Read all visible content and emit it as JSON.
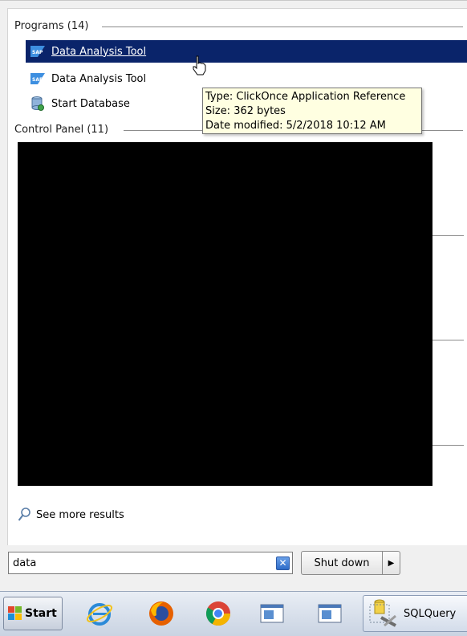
{
  "programs": {
    "header": "Programs (14)",
    "items": [
      {
        "label": "Data Analysis Tool",
        "icon": "sap-app-icon",
        "selected": true
      },
      {
        "label": "Data Analysis Tool",
        "icon": "sap-app-icon",
        "selected": false
      },
      {
        "label": "Start Database",
        "icon": "database-icon",
        "selected": false
      }
    ]
  },
  "tooltip": {
    "type": "Type: ClickOnce Application Reference",
    "size": "Size: 362 bytes",
    "modified": "Date modified: 5/2/2018 10:12 AM"
  },
  "control_panel": {
    "header": "Control Panel (11)"
  },
  "see_more": "See more results",
  "search": {
    "value": "data"
  },
  "shutdown": {
    "label": "Shut down"
  },
  "taskbar": {
    "start_label": "Start",
    "sql_label": "SQLQuery"
  },
  "colors": {
    "selection": "#0a246a",
    "tooltip_bg": "#ffffe1"
  }
}
